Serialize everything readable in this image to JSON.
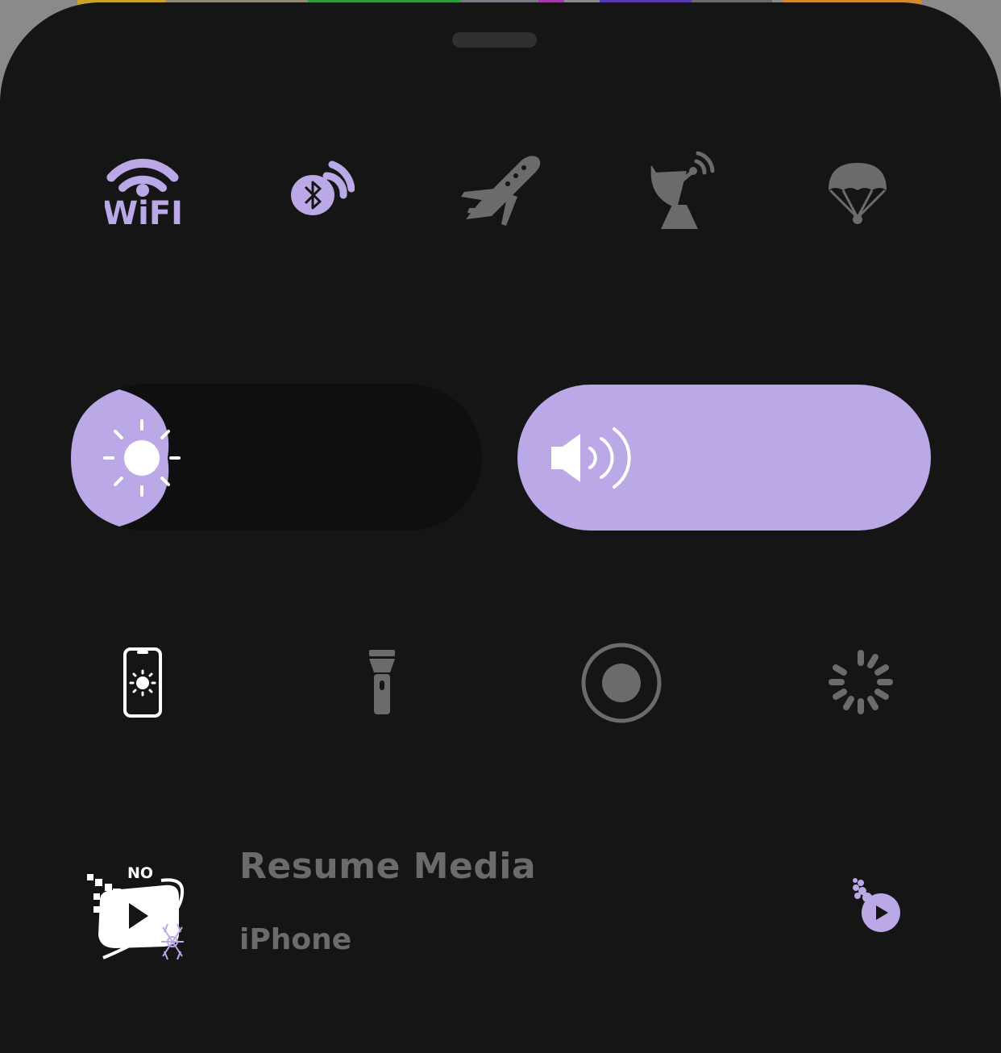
{
  "colors": {
    "panel": "#151516",
    "accent": "#baa9e6",
    "inactive": "#6b6b6e",
    "active_icon": "#ffffff"
  },
  "background_apps": [
    "#c9a228",
    "#8f8a7a",
    "#2f9b3a",
    "#7a7a82",
    "#a23aa8",
    "#5a3ab0",
    "#6a6a6a",
    "#d58a2a"
  ],
  "connectivity": [
    {
      "id": "wifi",
      "icon": "wifi-icon",
      "label": "WiFI",
      "active": true
    },
    {
      "id": "bluetooth",
      "icon": "bluetooth-icon",
      "active": true
    },
    {
      "id": "airplane",
      "icon": "airplane-icon",
      "active": false
    },
    {
      "id": "cellular",
      "icon": "satellite-dish-icon",
      "active": false
    },
    {
      "id": "airdrop",
      "icon": "parachute-icon",
      "active": false
    }
  ],
  "sliders": {
    "brightness": {
      "icon": "sun-icon",
      "level": 0.12
    },
    "volume": {
      "icon": "speaker-icon",
      "level": 1.0
    }
  },
  "toggles": [
    {
      "id": "auto-brightness",
      "icon": "phone-brightness-icon",
      "active": true
    },
    {
      "id": "flashlight",
      "icon": "flashlight-icon",
      "active": false
    },
    {
      "id": "screen-record",
      "icon": "record-icon",
      "active": false
    },
    {
      "id": "loading",
      "icon": "spinner-icon",
      "active": false
    }
  ],
  "media": {
    "title": "Resume Media",
    "subtitle": "iPhone",
    "badge": "NO",
    "artwork_icon": "no-video-logo-icon",
    "play_icon": "play-bubble-icon"
  }
}
